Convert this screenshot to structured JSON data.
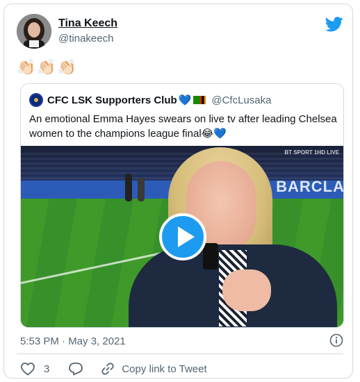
{
  "tweet": {
    "author": {
      "display_name": "Tina Keech",
      "handle": "@tinakeech"
    },
    "body_emojis": "👏🏻👏🏻👏🏻",
    "timestamp": "5:53 PM · May 3, 2021",
    "like_count": "3",
    "copy_link_label": "Copy link to Tweet"
  },
  "quoted_tweet": {
    "display_name": "CFC LSK Supporters Club",
    "name_emojis": "💙",
    "handle": "@CfcLusaka",
    "text": "An emotional Emma Hayes swears on live tv after leading Chelsea women to the champions league final😂💙",
    "media": {
      "type": "video",
      "broadcaster_watermark": "BT SPORT 1HD LIVE",
      "board_text": "BARCLA"
    }
  },
  "colors": {
    "accent": "#1d9bf0",
    "text_secondary": "#536471",
    "border": "#cfd9de"
  },
  "icons": [
    "twitter-bird-icon",
    "info-icon",
    "like-heart-icon",
    "reply-icon",
    "link-icon",
    "play-icon"
  ]
}
